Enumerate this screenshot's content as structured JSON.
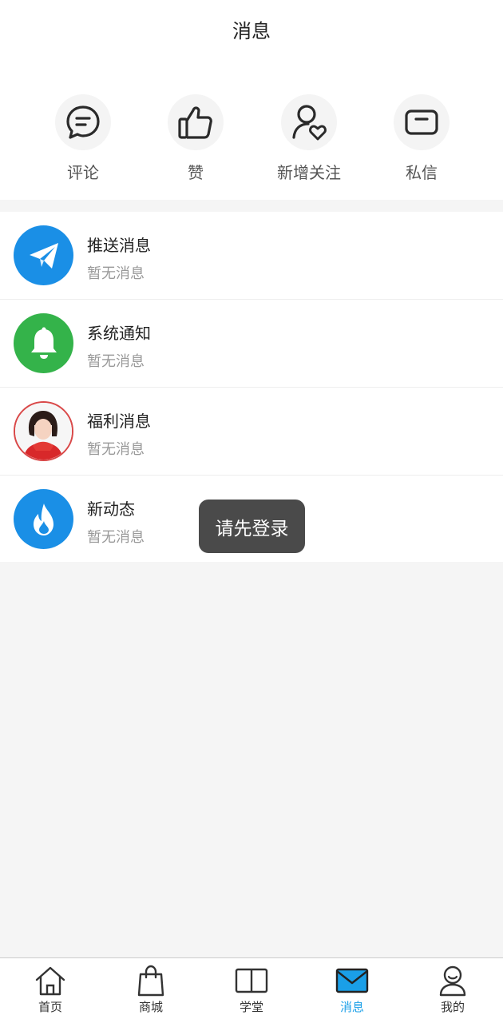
{
  "header": {
    "title": "消息"
  },
  "quick_actions": [
    {
      "label": "评论",
      "icon": "comment-icon"
    },
    {
      "label": "赞",
      "icon": "thumbs-up-icon"
    },
    {
      "label": "新增关注",
      "icon": "new-follower-icon"
    },
    {
      "label": "私信",
      "icon": "private-message-icon"
    }
  ],
  "messages": [
    {
      "title": "推送消息",
      "subtitle": "暂无消息",
      "icon": "paper-plane-icon",
      "color": "#1a8fe6"
    },
    {
      "title": "系统通知",
      "subtitle": "暂无消息",
      "icon": "bell-icon",
      "color": "#34b34a"
    },
    {
      "title": "福利消息",
      "subtitle": "暂无消息",
      "icon": "welfare-avatar",
      "color": "#d94848"
    },
    {
      "title": "新动态",
      "subtitle": "暂无消息",
      "icon": "flame-icon",
      "color": "#1a8fe6"
    }
  ],
  "toast": {
    "text": "请先登录"
  },
  "tabbar": {
    "active_color": "#1a9fe8",
    "items": [
      {
        "label": "首页",
        "icon": "home-icon"
      },
      {
        "label": "商城",
        "icon": "shopping-bag-icon"
      },
      {
        "label": "学堂",
        "icon": "book-icon"
      },
      {
        "label": "消息",
        "icon": "mail-icon",
        "active": true
      },
      {
        "label": "我的",
        "icon": "user-icon"
      }
    ]
  }
}
